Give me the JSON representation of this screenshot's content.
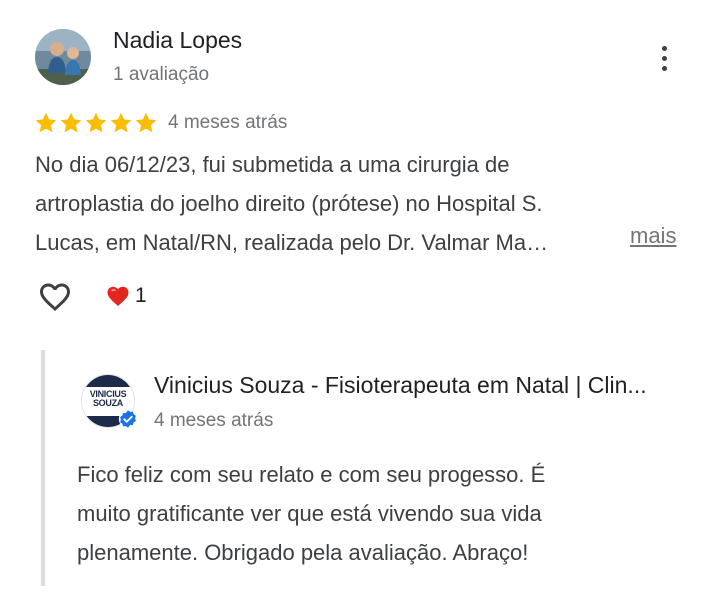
{
  "review": {
    "author_name": "Nadia Lopes",
    "author_meta": "1 avaliação",
    "rating": 5,
    "date": "4 meses atrás",
    "text_lines": [
      "No dia 06/12/23, fui submetida a uma cirurgia de",
      "artroplastia do joelho direito (prótese) no Hospital S.",
      "Lucas, em Natal/RN, realizada pelo Dr. Valmar Ma…"
    ],
    "more_label": "mais",
    "reaction_count": "1",
    "icons": {
      "menu": "more-vert-icon",
      "like": "heart-outline-icon",
      "reaction": "red-heart-icon",
      "star": "star-icon"
    },
    "star_color": "#fbbc04"
  },
  "owner_reply": {
    "owner_name": "Vinicius Souza - Fisioterapeuta em Natal | Clin...",
    "date": "4 meses atrás",
    "logo_lines": [
      "VINICIUS",
      "SOUZA"
    ],
    "text_lines": [
      "Fico feliz com seu relato e com seu progesso. É",
      "muito gratificante ver que está vivendo sua vida",
      "plenamente. Obrigado pela avaliação. Abraço!"
    ],
    "verified_icon": "verified-badge-icon",
    "verified_color": "#1a73e8"
  }
}
